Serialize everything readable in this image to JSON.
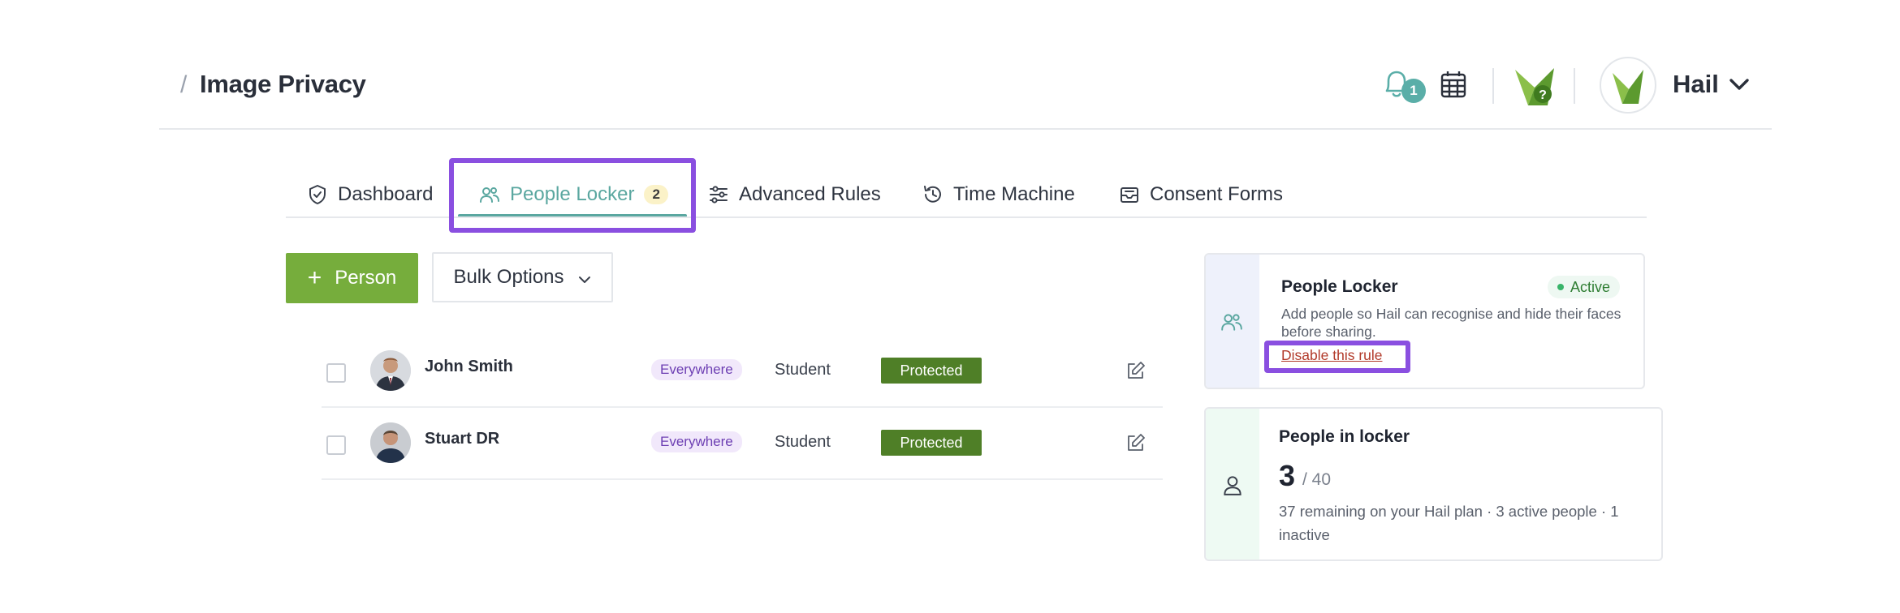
{
  "header": {
    "breadcrumb_separator": "/",
    "title": "Image Privacy",
    "notifications_count": "1",
    "user_name": "Hail"
  },
  "tabs": [
    {
      "label": "Dashboard",
      "icon": "shield-check-icon"
    },
    {
      "label": "People Locker",
      "icon": "users-icon",
      "count": "2",
      "active": true
    },
    {
      "label": "Advanced Rules",
      "icon": "sliders-icon"
    },
    {
      "label": "Time Machine",
      "icon": "history-icon"
    },
    {
      "label": "Consent Forms",
      "icon": "inbox-icon"
    }
  ],
  "toolbar": {
    "add_person_label": "Person",
    "bulk_options_label": "Bulk Options"
  },
  "people": [
    {
      "name": "John Smith",
      "scope": "Everywhere",
      "role": "Student",
      "status": "Protected"
    },
    {
      "name": "Stuart DR",
      "scope": "Everywhere",
      "role": "Student",
      "status": "Protected"
    }
  ],
  "locker_card": {
    "title": "People Locker",
    "status": "Active",
    "description": "Add people so Hail can recognise and hide their faces before sharing.",
    "disable_link": "Disable this rule"
  },
  "count_card": {
    "title": "People in locker",
    "count": "3",
    "limit": "/ 40",
    "description": "37 remaining on your Hail plan · 3 active people · 1 inactive"
  },
  "colors": {
    "accent": "#5aa7a0",
    "primary_button": "#76ad3c",
    "protected": "#4f7f27",
    "highlight": "#8a4fe0"
  }
}
